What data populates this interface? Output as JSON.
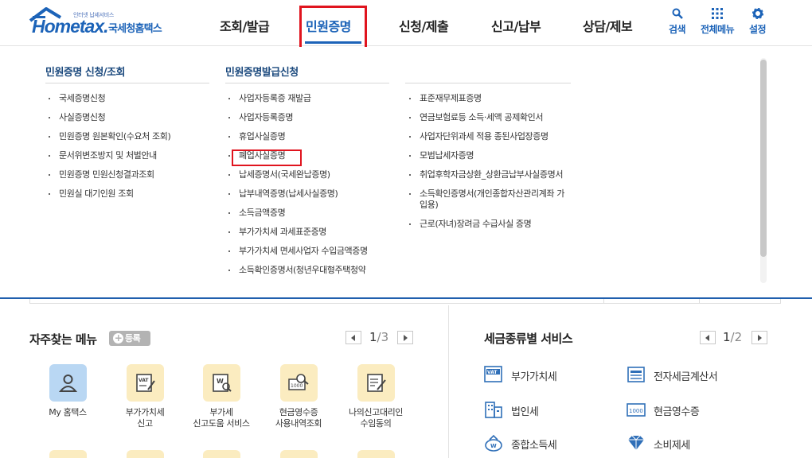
{
  "header": {
    "logo_sub": "인터넷 납세서비스",
    "logo_word": "Hometax.",
    "logo_kr": "국세청홈택스",
    "gnb": [
      "조회/발급",
      "민원증명",
      "신청/제출",
      "신고/납부",
      "상담/제보"
    ],
    "util": {
      "search": "검색",
      "all_menu": "전체메뉴",
      "settings": "설정"
    }
  },
  "mega": {
    "col1": {
      "title": "민원증명 신청/조회",
      "items": [
        "국세증명신청",
        "사실증명신청",
        "민원증명 원본확인(수요처 조회)",
        "문서위변조방지 및 처벌안내",
        "민원증명 민원신청결과조회",
        "민원실 대기인원 조회"
      ]
    },
    "col2": {
      "title": "민원증명발급신청",
      "items": [
        "사업자등록증 재발급",
        "사업자등록증명",
        "휴업사실증명",
        "폐업사실증명",
        "납세증명서(국세완납증명)",
        "납부내역증명(납세사실증명)",
        "소득금액증명",
        "부가가치세 과세표준증명",
        "부가가치세 면세사업자 수입금액증명",
        "소득확인증명서(청년우대형주택청약"
      ]
    },
    "col3": {
      "items": [
        "표준재무제표증명",
        "연금보험료등 소득·세액 공제확인서",
        "사업자단위과세 적용 종된사업장증명",
        "모범납세자증명",
        "취업후학자금상환_상환금납부사실증명서",
        "소득확인증명서(개인종합자산관리계좌 가입용)",
        "근로(자녀)장려금 수급사실 증명"
      ]
    }
  },
  "favorites": {
    "title": "자주찾는 메뉴",
    "add_label": "등록",
    "page": "1",
    "total": "/3",
    "items": [
      {
        "label": "My 홈택스",
        "icon": "person-icon"
      },
      {
        "label": "부가가치세\n신고",
        "icon": "vat-document-icon"
      },
      {
        "label": "부가세\n신고도움 서비스",
        "icon": "vat-help-icon"
      },
      {
        "label": "현금영수증\n사용내역조회",
        "icon": "cash-receipt-search-icon"
      },
      {
        "label": "나의신고대리인\n수임동의",
        "icon": "document-edit-icon"
      }
    ]
  },
  "tax_services": {
    "title": "세금종류별 서비스",
    "page": "1",
    "total": "/2",
    "items": [
      "부가가치세",
      "전자세금계산서",
      "법인세",
      "현금영수증",
      "종합소득세",
      "소비제세"
    ]
  },
  "colors": {
    "brand": "#1c63b8",
    "highlight": "#e0141e",
    "fav_bg": "#fbecc0",
    "my_bg": "#b9d7f3"
  }
}
